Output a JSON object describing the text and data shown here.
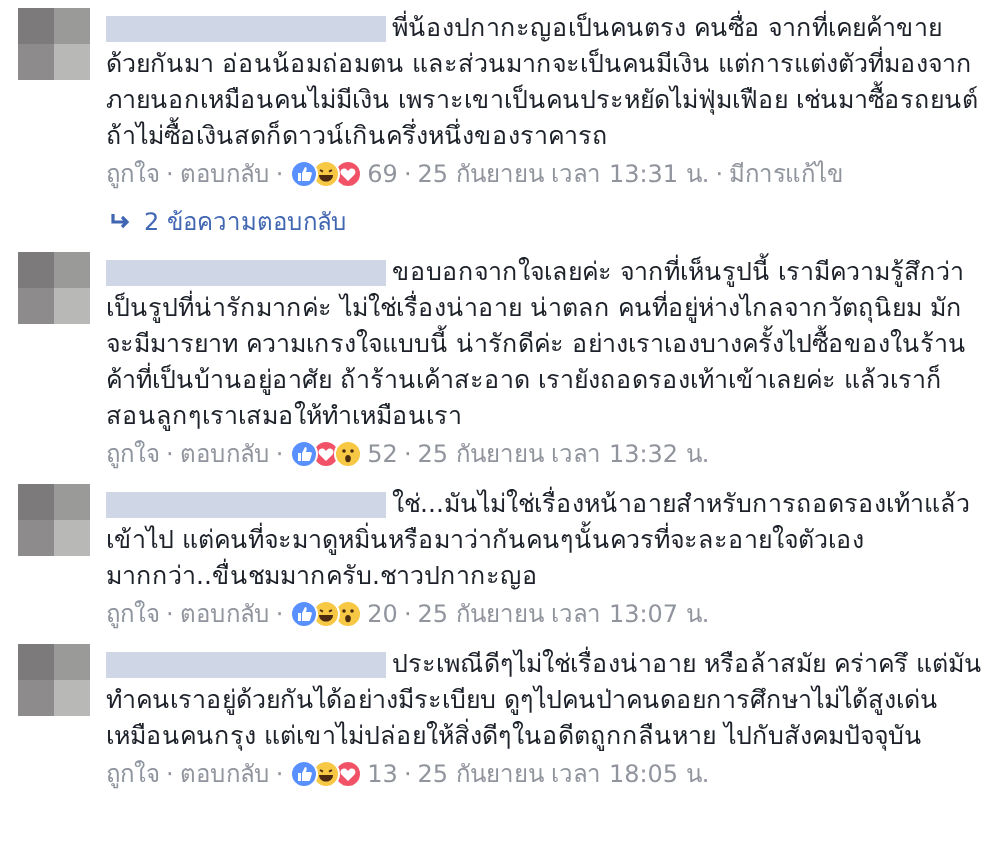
{
  "separator": "·",
  "comments": [
    {
      "text": "พี่น้องปกากะญอเป็นคนตรง คนซื่อ จากที่เคยค้าขายด้วยกันมา อ่อนน้อมถ่อมตน และส่วนมากจะเป็นคนมีเงิน แต่การแต่งตัวที่มองจากภายนอกเหมือนคนไม่มีเงิน เพราะเขาเป็นคนประหยัดไม่ฟุ่มเฟือย เช่นมาซื้อรถยนต์ถ้าไม่ซื้อเงินสดก็ดาวน์เกินครึ่งหนึ่งของราคารถ",
      "like_label": "ถูกใจ",
      "reply_label": "ตอบกลับ",
      "reactions": [
        {
          "kind": "like"
        },
        {
          "kind": "haha"
        },
        {
          "kind": "love"
        }
      ],
      "count": "69",
      "time": "25 กันยายน เวลา 13:31 น.",
      "edited": "มีการแก้ไข",
      "replies_link": "2 ข้อความตอบกลับ"
    },
    {
      "text": "ขอบอกจากใจเลยค่ะ จากที่เห็นรูปนี้ เรามีความรู้สึกว่าเป็นรูปที่น่ารักมากค่ะ ไม่ใช่เรื่องน่าอาย น่าตลก คนที่อยู่ห่างไกลจากวัตถุนิยม มักจะมีมารยาท ความเกรงใจแบบนี้ น่ารักดีค่ะ อย่างเราเองบางครั้งไปซื้อของในร้านค้าที่เป็นบ้านอยู่อาศัย ถ้าร้านเค้าสะอาด เรายังถอดรองเท้าเข้าเลยค่ะ แล้วเราก็สอนลูกๆเราเสมอให้ทำเหมือนเรา",
      "like_label": "ถูกใจ",
      "reply_label": "ตอบกลับ",
      "reactions": [
        {
          "kind": "like"
        },
        {
          "kind": "love"
        },
        {
          "kind": "wow"
        }
      ],
      "count": "52",
      "time": "25 กันยายน เวลา 13:32 น."
    },
    {
      "text": "ใช่...มันไม่ใช่เรื่องหน้าอายสำหรับการถอดรองเท้าแล้วเข้าไป แต่คนที่จะมาดูหมิ่นหรือมาว่ากันคนๆนั้นควรที่จะละอายใจตัวเองมากกว่า..ขื่นชมมากครับ.ชาวปกากะญอ",
      "like_label": "ถูกใจ",
      "reply_label": "ตอบกลับ",
      "reactions": [
        {
          "kind": "like"
        },
        {
          "kind": "haha"
        },
        {
          "kind": "wow"
        }
      ],
      "count": "20",
      "time": "25 กันยายน เวลา 13:07 น."
    },
    {
      "text": "ประเพณีดีๆไม่ใช่เรื่องน่าอาย หรือล้าสมัย คร่าครึ แต่มันทำคนเราอยู่ด้วยกันได้อย่างมีระเบียบ ดูๆไปคนป่าคนดอยการศึกษาไม่ได้สูงเด่นเหมือนคนกรุง แต่เขาไม่ปล่อยให้สิ่งดีๆในอดีตถูกกลืนหาย ไปกับสังคมปัจจุบัน",
      "like_label": "ถูกใจ",
      "reply_label": "ตอบกลับ",
      "reactions": [
        {
          "kind": "like"
        },
        {
          "kind": "haha"
        },
        {
          "kind": "love"
        }
      ],
      "count": "13",
      "time": "25 กันยายน เวลา 18:05 น."
    }
  ]
}
